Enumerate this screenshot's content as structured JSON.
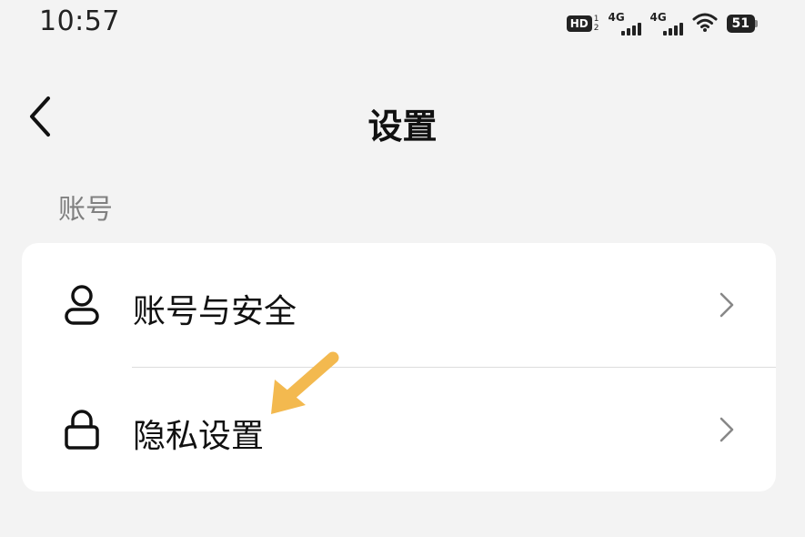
{
  "status_bar": {
    "time": "10:57",
    "hd_label": "HD",
    "hd_sub_top": "1",
    "hd_sub_bottom": "2",
    "sim1_label": "4G",
    "sim2_label": "4G",
    "wifi_icon": "wifi-icon",
    "battery_level": "51"
  },
  "header": {
    "back_icon": "chevron-left-icon",
    "title": "设置"
  },
  "section": {
    "label": "账号"
  },
  "list": {
    "items": [
      {
        "icon": "user-icon",
        "label": "账号与安全",
        "chevron": "chevron-right-icon"
      },
      {
        "icon": "lock-icon",
        "label": "隐私设置",
        "chevron": "chevron-right-icon"
      }
    ]
  },
  "annotation": {
    "arrow_color": "#f3b94f"
  },
  "colors": {
    "background": "#f3f3f3",
    "card": "#ffffff",
    "section_label": "#808080",
    "text": "#111111",
    "chevron": "#888888"
  }
}
